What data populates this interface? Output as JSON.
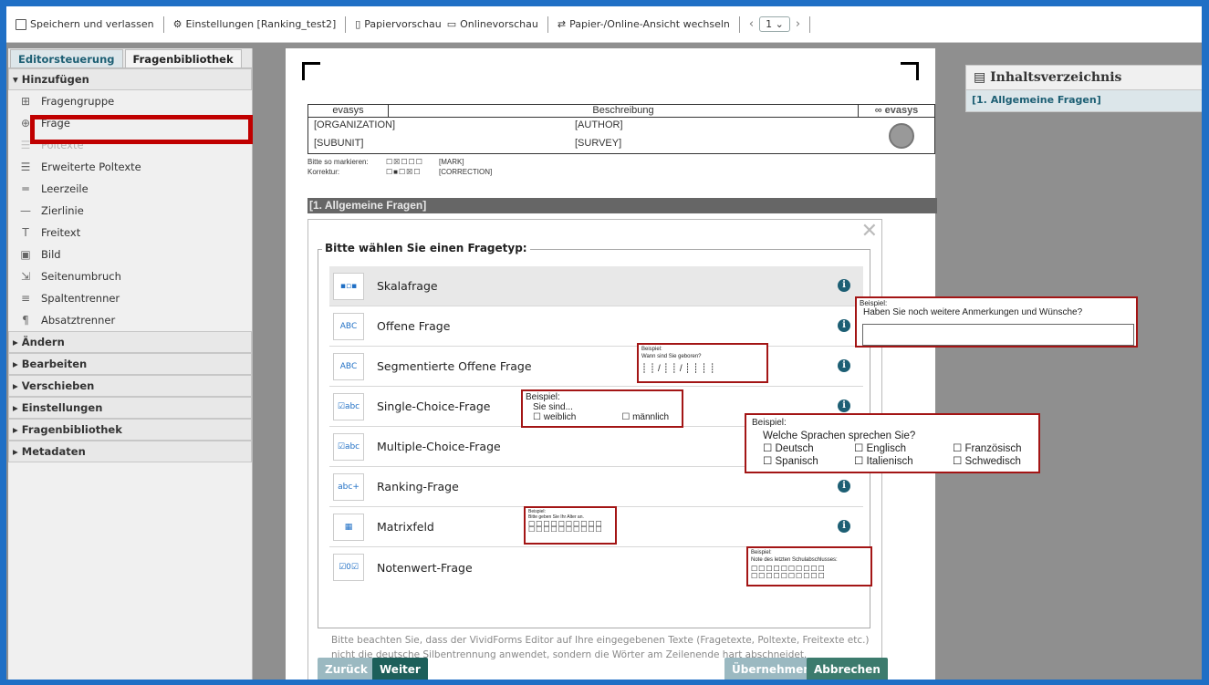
{
  "toolbar": {
    "save": "Speichern und verlassen",
    "settings": "Einstellungen [Ranking_test2]",
    "paper_preview": "Papiervorschau",
    "online_preview": "Onlinevorschau",
    "switch_view": "Papier-/Online-Ansicht wechseln",
    "page": "1"
  },
  "left": {
    "tabs": [
      "Editorsteuerung",
      "Fragenbibliothek"
    ],
    "add_section": "Hinzufügen",
    "items": [
      {
        "label": "Fragengruppe",
        "icon": "folder-plus-icon"
      },
      {
        "label": "Frage",
        "icon": "add-question-icon"
      },
      {
        "label": "Poltexte",
        "icon": "lines-icon"
      },
      {
        "label": "Erweiterte Poltexte",
        "icon": "lines-extended-icon"
      },
      {
        "label": "Leerzeile",
        "icon": "blank-line-icon"
      },
      {
        "label": "Zierlinie",
        "icon": "decor-line-icon"
      },
      {
        "label": "Freitext",
        "icon": "text-icon"
      },
      {
        "label": "Bild",
        "icon": "image-icon"
      },
      {
        "label": "Seitenumbruch",
        "icon": "page-break-icon"
      },
      {
        "label": "Spaltentrenner",
        "icon": "column-icon"
      },
      {
        "label": "Absatztrenner",
        "icon": "pilcrow-icon"
      }
    ],
    "sections": [
      "Ändern",
      "Bearbeiten",
      "Verschieben",
      "Einstellungen",
      "Fragenbibliothek",
      "Metadaten"
    ]
  },
  "doc": {
    "brand": "evasys",
    "beschreibung": "Beschreibung",
    "logo": "evasys",
    "org": "[ORGANIZATION]",
    "author": "[AUTHOR]",
    "subunit": "[SUBUNIT]",
    "survey": "[SURVEY]",
    "mark_label": "Bitte so markieren:",
    "mark_tag": "[MARK]",
    "corr_label": "Korrektur:",
    "corr_tag": "[CORRECTION]",
    "section_title": "[1. Allgemeine Fragen]"
  },
  "toc": {
    "title": "Inhaltsverzeichnis",
    "item": "[1. Allgemeine Fragen]"
  },
  "modal": {
    "legend": "Bitte wählen Sie einen Fragetyp:",
    "types": [
      {
        "label": "Skalafrage",
        "icon": "scale-icon"
      },
      {
        "label": "Offene Frage",
        "icon": "open-question-icon"
      },
      {
        "label": "Segmentierte Offene Frage",
        "icon": "segmented-icon"
      },
      {
        "label": "Single-Choice-Frage",
        "icon": "single-choice-icon"
      },
      {
        "label": "Multiple-Choice-Frage",
        "icon": "multiple-choice-icon"
      },
      {
        "label": "Ranking-Frage",
        "icon": "ranking-icon"
      },
      {
        "label": "Matrixfeld",
        "icon": "matrix-icon"
      },
      {
        "label": "Notenwert-Frage",
        "icon": "grade-icon"
      }
    ],
    "note": "Bitte beachten Sie, dass der VividForms Editor auf Ihre eingegebenen Texte (Fragetexte, Poltexte, Freitexte etc.) nicht die deutsche Silbentrennung anwendet, sondern die Wörter am Zeilenende hart abschneidet.",
    "buttons": {
      "back": "Zurück",
      "next": "Weiter",
      "apply": "Übernehmen",
      "cancel": "Abbrechen"
    }
  },
  "examples": {
    "heading": "Beispiel:",
    "open": "Haben Sie noch weitere Anmerkungen und Wünsche?",
    "segmented": "Wann sind Sie geboren?",
    "single_q": "Sie sind...",
    "single_opts": [
      "weiblich",
      "männlich"
    ],
    "lang_q": "Welche Sprachen sprechen Sie?",
    "lang_opts": [
      "Deutsch",
      "Englisch",
      "Französisch",
      "Spanisch",
      "Italienisch",
      "Schwedisch"
    ],
    "matrix": "Bitte geben Sie Ihr Alter an.",
    "grade": "Note des letzten Schulabschlusses:"
  }
}
